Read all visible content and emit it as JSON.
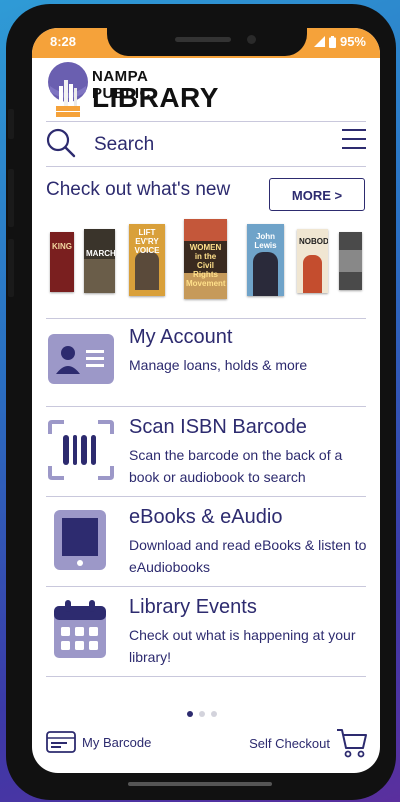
{
  "status": {
    "time": "8:28",
    "battery": "95%"
  },
  "logo": {
    "line1": "NAMPA PUBLIC",
    "line2": "LIBRARY"
  },
  "search": {
    "placeholder": "Search"
  },
  "new_section": {
    "title": "Check out what's new",
    "more_label": "MORE >"
  },
  "carousel": [
    {
      "label": "KING",
      "color": "#7a1f1f"
    },
    {
      "label": "MARCH",
      "color": "#3a342b"
    },
    {
      "label": "LIFT EV'RY VOICE",
      "color": "#d9a03a"
    },
    {
      "label": "WOMEN in the Civil Rights Movement",
      "color": "#3a2a1f"
    },
    {
      "label": "John Lewis",
      "color": "#6fa3c9"
    },
    {
      "label": "NOBODY",
      "color": "#c44d2e"
    },
    {
      "label": "",
      "color": "#4a4a4a"
    }
  ],
  "menu": [
    {
      "title": "My Account",
      "desc": "Manage loans, holds & more"
    },
    {
      "title": "Scan ISBN Barcode",
      "desc": "Scan the barcode on the back of a book or audiobook to search"
    },
    {
      "title": "eBooks & eAudio",
      "desc": "Download and read eBooks & listen to eAudiobooks"
    },
    {
      "title": "Library Events",
      "desc": "Check out what is happening at your library!"
    }
  ],
  "bottom": {
    "barcode_label": "My Barcode",
    "checkout_label": "Self Checkout"
  },
  "colors": {
    "accent": "#f5a23a",
    "primary": "#2d2b6f",
    "icon": "#9c98c8"
  }
}
